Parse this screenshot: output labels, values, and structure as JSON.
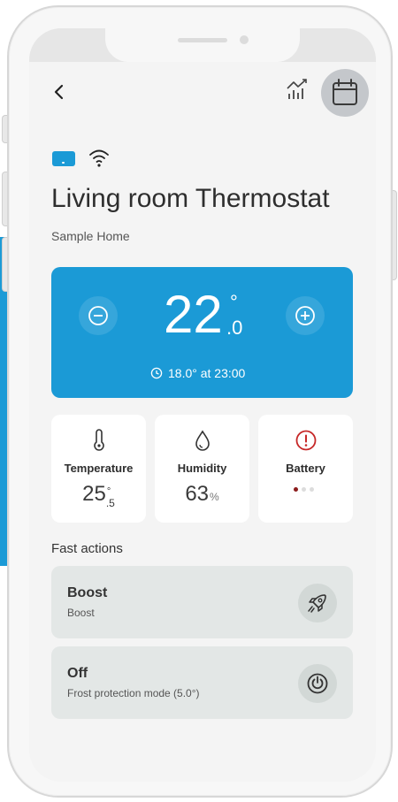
{
  "header": {
    "title": "Living room Thermostat",
    "subtitle": "Sample Home"
  },
  "icons": {
    "back": "chevron-left-icon",
    "statistics": "chart-icon",
    "schedule": "calendar-icon",
    "device": "thermostat-device-icon",
    "connection": "wifi-icon"
  },
  "setpoint": {
    "integer": "22",
    "decimal": ".0",
    "degree": "°",
    "schedule_text": "18.0° at 23:00"
  },
  "stats": [
    {
      "label": "Temperature",
      "integer": "25",
      "decimal": ".5",
      "unit": "°"
    },
    {
      "label": "Humidity",
      "value": "63",
      "unit": "%"
    },
    {
      "label": "Battery",
      "level_dots_filled": 1,
      "level_dots_total": 3
    }
  ],
  "fast_actions": {
    "title": "Fast actions",
    "items": [
      {
        "name": "Boost",
        "description": "Boost",
        "icon": "rocket-icon"
      },
      {
        "name": "Off",
        "description": "Frost protection mode (5.0°)",
        "icon": "power-icon"
      }
    ]
  },
  "colors": {
    "accent": "#1b9ad6",
    "battery_warning": "#c62828",
    "card_bg": "#ffffff",
    "action_bg": "#e3e7e6"
  }
}
